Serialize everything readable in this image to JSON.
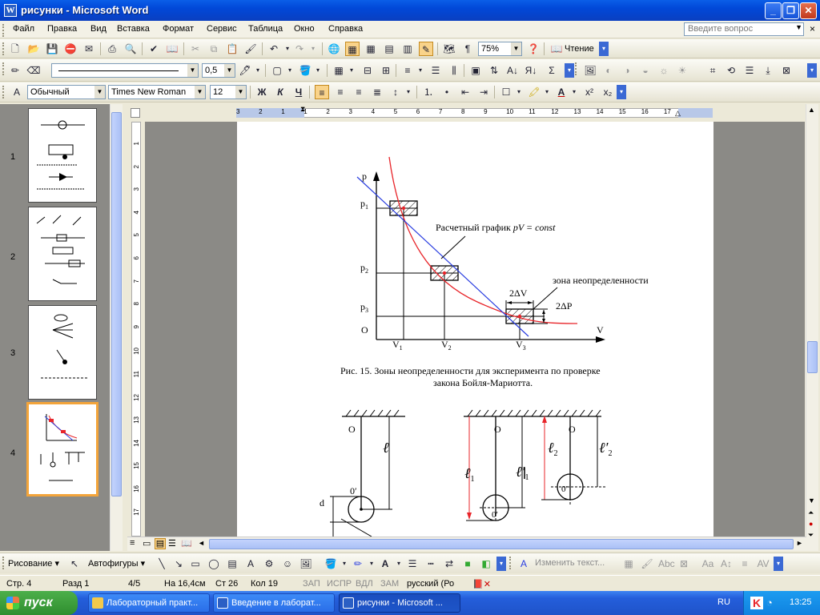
{
  "window": {
    "title": "рисунки - Microsoft Word"
  },
  "menu": [
    "Файл",
    "Правка",
    "Вид",
    "Вставка",
    "Формат",
    "Сервис",
    "Таблица",
    "Окно",
    "Справка"
  ],
  "help_placeholder": "Введите вопрос",
  "toolbar1": {
    "zoom": "75%",
    "reading_label": "Чтение"
  },
  "toolbar2": {
    "line_weight": "0,5"
  },
  "toolbar3": {
    "style": "Обычный",
    "font": "Times New Roman",
    "size": "12",
    "bold": "Ж",
    "italic": "К",
    "underline": "Ч"
  },
  "thumbnails": [
    {
      "num": "1"
    },
    {
      "num": "2"
    },
    {
      "num": "3"
    },
    {
      "num": "4"
    }
  ],
  "ruler": {
    "h_labels": [
      "3",
      "2",
      "1",
      "1",
      "2",
      "3",
      "4",
      "5",
      "6",
      "7",
      "8",
      "9",
      "10",
      "11",
      "12",
      "13",
      "14",
      "15",
      "16",
      "17"
    ],
    "v_labels": [
      "1",
      "2",
      "3",
      "4",
      "5",
      "6",
      "7",
      "8",
      "9",
      "10",
      "11",
      "12",
      "13",
      "14",
      "15",
      "16",
      "17"
    ]
  },
  "figure1": {
    "axis_p": "p",
    "axis_v": "V",
    "origin": "O",
    "p1": "p",
    "p1_sub": "1",
    "p2": "p",
    "p2_sub": "2",
    "p3": "p",
    "p3_sub": "3",
    "v1": "V",
    "v1_sub": "1",
    "v2": "V",
    "v2_sub": "2",
    "v3": "V",
    "v3_sub": "3",
    "calc_label_prefix": "Расчетный график",
    "calc_label_formula": "pV = const",
    "zone_label": "зона неопределенности",
    "dv_label": "2ΔV",
    "dp_label": "2ΔP",
    "caption_line1": "Рис. 15. Зоны неопределенности для эксперимента по проверке",
    "caption_line2": "закона Бойля-Мариотта."
  },
  "figure2": {
    "o": "O",
    "l": "ℓ",
    "o_prime": "0′",
    "d": "d",
    "l1": "ℓ",
    "l1_sub": "1",
    "l1p": "ℓ′",
    "l1p_sub": "1",
    "l2": "ℓ",
    "l2_sub": "2",
    "l2p": "ℓ′",
    "l2p_sub": "2"
  },
  "drawbar": {
    "draw_label": "Рисование",
    "autoshapes_label": "Автофигуры",
    "text_change_label": "Изменить текст..."
  },
  "status": {
    "page": "Стр.  4",
    "section": "Разд  1",
    "pages": "4/5",
    "at": "На 16,4см",
    "line": "Ст  26",
    "col": "Кол  19",
    "rec": "ЗАП",
    "trk": "ИСПР",
    "ext": "ВДЛ",
    "ovr": "ЗАМ",
    "lang": "русский (Ро"
  },
  "taskbar": {
    "start": "пуск",
    "tasks": [
      "Лабораторный практ...",
      "Введение в лаборат...",
      "рисунки - Microsoft ..."
    ],
    "lang": "RU",
    "time": "13:25"
  },
  "colors": {
    "curve_red": "#e8252a",
    "line_blue": "#2a3ee0",
    "active_thumb": "#f3a43a"
  }
}
